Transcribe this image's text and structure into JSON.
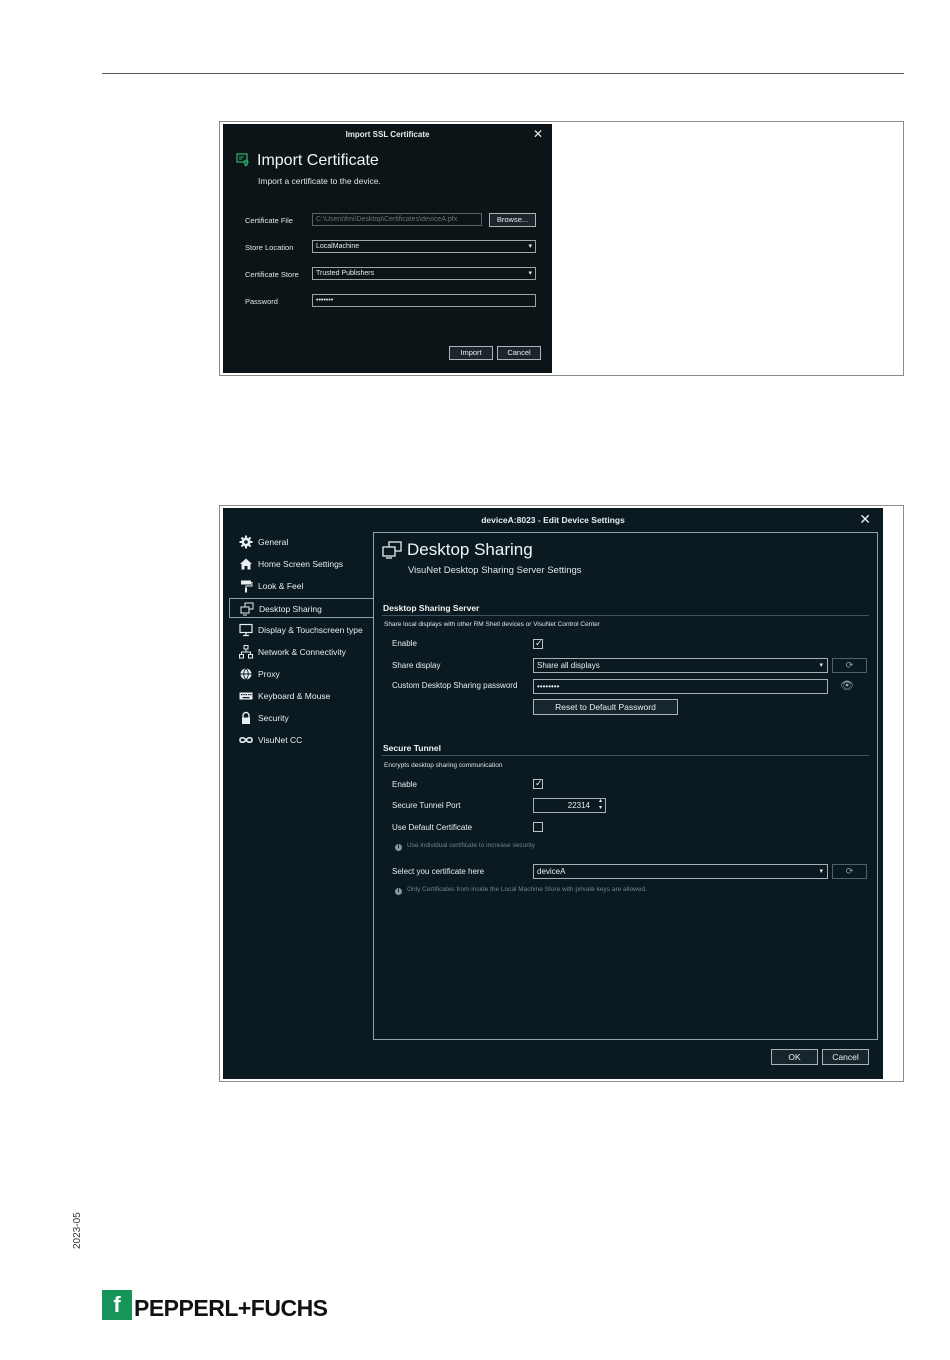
{
  "import_dialog": {
    "window_title": "Import SSL Certificate",
    "close": "✕",
    "heading": "Import Certificate",
    "subtitle": "Import a certificate to the device.",
    "fields": {
      "certificate_file_label": "Certificate File",
      "certificate_file_value": "C:\\Users\\fmi\\Desktop\\Certificates\\deviceA.pfx",
      "browse_label": "Browse...",
      "store_location_label": "Store Location",
      "store_location_value": "LocalMachine",
      "certificate_store_label": "Certificate Store",
      "certificate_store_value": "Trusted Publishers",
      "password_label": "Password",
      "password_value": "•••••••"
    },
    "import_label": "Import",
    "cancel_label": "Cancel"
  },
  "settings_dialog": {
    "window_title": "deviceA:8023 - Edit Device Settings",
    "close": "✕",
    "nav": [
      {
        "label": "General",
        "icon": "gear-icon"
      },
      {
        "label": "Home Screen Settings",
        "icon": "home-icon"
      },
      {
        "label": "Look & Feel",
        "icon": "paint-roller-icon"
      },
      {
        "label": "Desktop Sharing",
        "icon": "desktop-sharing-icon"
      },
      {
        "label": "Display & Touchscreen type",
        "icon": "monitor-icon"
      },
      {
        "label": "Network & Connectivity",
        "icon": "network-icon"
      },
      {
        "label": "Proxy",
        "icon": "globe-icon"
      },
      {
        "label": "Keyboard & Mouse",
        "icon": "keyboard-icon"
      },
      {
        "label": "Security",
        "icon": "lock-icon"
      },
      {
        "label": "VisuNet CC",
        "icon": "infinity-icon"
      }
    ],
    "active_nav": "Desktop Sharing",
    "panel_title": "Desktop Sharing",
    "panel_subtitle": "VisuNet Desktop Sharing Server Settings",
    "server": {
      "section_title": "Desktop Sharing Server",
      "section_desc": "Share local displays with other RM Shell devices or VisuNet Control Center",
      "enable_label": "Enable",
      "enable_checked": true,
      "share_display_label": "Share display",
      "share_display_value": "Share all displays",
      "password_label": "Custom Desktop Sharing password",
      "password_value": "••••••••",
      "reset_label": "Reset to Default Password"
    },
    "tunnel": {
      "section_title": "Secure Tunnel",
      "section_desc": "Encrypts desktop sharing communication",
      "enable_label": "Enable",
      "enable_checked": true,
      "port_label": "Secure Tunnel Port",
      "port_value": "22314",
      "default_cert_label": "Use Default Certificate",
      "default_cert_checked": false,
      "default_cert_hint": "Use individual certificate to increase security",
      "select_cert_label": "Select you certificate here",
      "select_cert_value": "deviceA",
      "select_cert_hint": "Only Certificates from inside the Local Machine Store with private keys are allowed."
    },
    "ok_label": "OK",
    "cancel_label": "Cancel"
  },
  "footer": {
    "year_code": "2023-05",
    "brand": "PEPPERL+FUCHS",
    "brand_mark": "f",
    "brand_color": "#16955a"
  }
}
